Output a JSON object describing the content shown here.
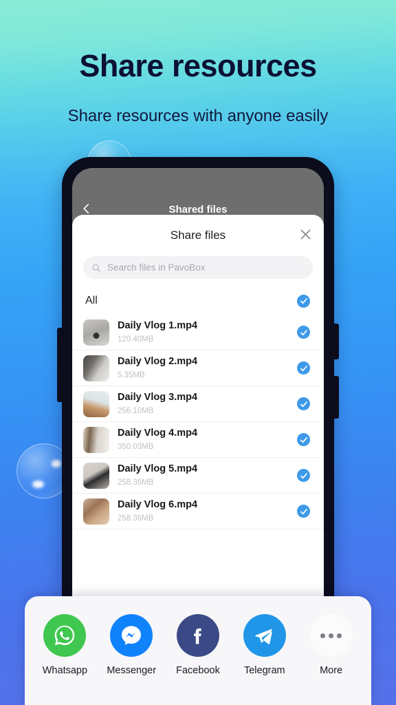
{
  "promo": {
    "headline": "Share resources",
    "subheadline": "Share resources with anyone easily"
  },
  "theme": {
    "gradient_top": "#8aecd6",
    "gradient_mid": "#35a2f6",
    "gradient_bottom": "#5570e8",
    "accent_check": "#3d9ae8",
    "heading_color": "#0c1034"
  },
  "host_screen": {
    "title": "Shared files",
    "back_icon": "chevron-left-icon"
  },
  "modal": {
    "title": "Share files",
    "close_icon": "close-icon",
    "search": {
      "icon": "search-icon",
      "placeholder": "Search files in PavoBox",
      "value": ""
    },
    "select_all": {
      "label": "All",
      "checked": true
    },
    "files": [
      {
        "name": "Daily Vlog 1.mp4",
        "size": "120.40MB",
        "checked": true,
        "thumb": "deer-photo-thumbnail"
      },
      {
        "name": "Daily Vlog 2.mp4",
        "size": "5.35MB",
        "checked": true,
        "thumb": "dark-scene-thumbnail"
      },
      {
        "name": "Daily Vlog 3.mp4",
        "size": "256.10MB",
        "checked": true,
        "thumb": "table-scene-thumbnail"
      },
      {
        "name": "Daily Vlog 4.mp4",
        "size": "350.03MB",
        "checked": true,
        "thumb": "doorway-thumbnail"
      },
      {
        "name": "Daily Vlog 5.mp4",
        "size": "258.36MB",
        "checked": true,
        "thumb": "camera-tripod-thumbnail"
      },
      {
        "name": "Daily Vlog 6.mp4",
        "size": "258.36MB",
        "checked": true,
        "thumb": "interior-thumbnail"
      }
    ]
  },
  "share_sheet": {
    "targets": [
      {
        "label": "Whatsapp",
        "icon": "whatsapp-icon",
        "color": "#3fc74f"
      },
      {
        "label": "Messenger",
        "icon": "messenger-icon",
        "color": "#1082fc"
      },
      {
        "label": "Facebook",
        "icon": "facebook-icon",
        "color": "#3b4a86"
      },
      {
        "label": "Telegram",
        "icon": "telegram-icon",
        "color": "#2196e8"
      },
      {
        "label": "More",
        "icon": "more-dots-icon",
        "color": "#fbfbfc"
      }
    ]
  }
}
